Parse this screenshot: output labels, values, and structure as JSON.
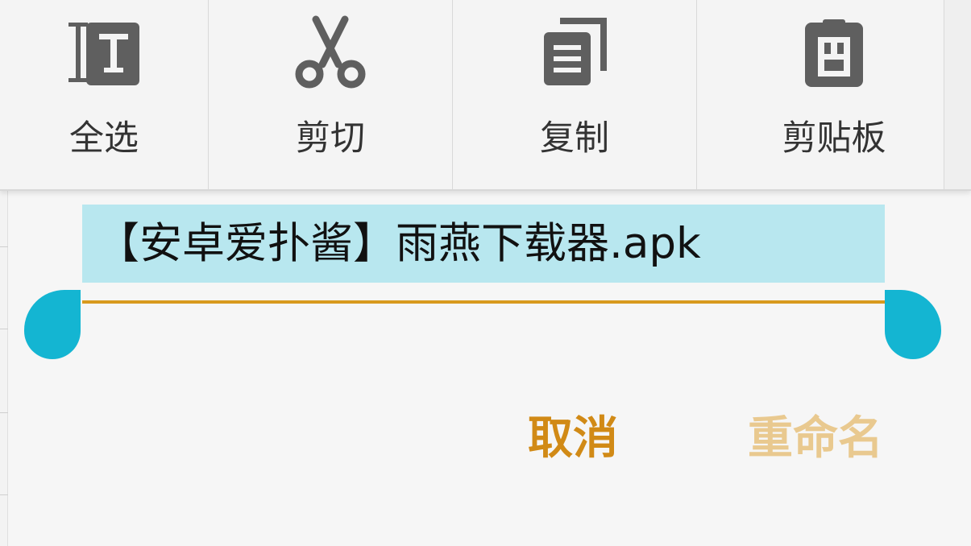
{
  "toolbar": {
    "items": [
      {
        "label": "全选",
        "icon": "select-all-icon"
      },
      {
        "label": "剪切",
        "icon": "cut-icon"
      },
      {
        "label": "复制",
        "icon": "copy-icon"
      },
      {
        "label": "剪贴板",
        "icon": "clipboard-icon"
      }
    ]
  },
  "dialog": {
    "filename_value": "【安卓爱扑酱】雨燕下载器.apk",
    "cancel_label": "取消",
    "rename_label": "重命名"
  },
  "colors": {
    "selection_bg": "#b8e7ef",
    "accent": "#d89a1e",
    "handle": "#14b5d2",
    "cancel_text": "#d18a16",
    "rename_text_disabled": "#e9c98f"
  }
}
